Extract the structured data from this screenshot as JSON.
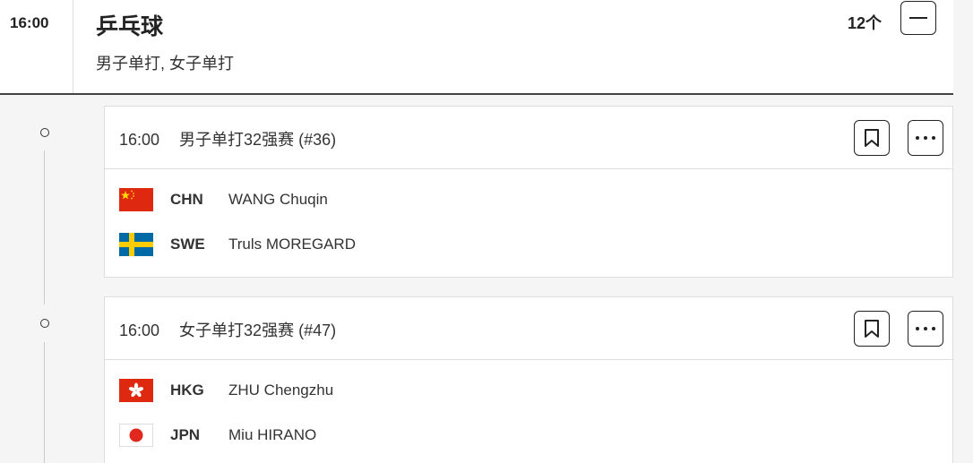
{
  "header": {
    "time": "16:00",
    "sport": "乒乓球",
    "events": "男子单打, 女子单打",
    "count": "12个"
  },
  "matches": [
    {
      "time": "16:00",
      "title": "男子单打32强赛",
      "number": "(#36)",
      "competitors": [
        {
          "code": "CHN",
          "name": "WANG Chuqin",
          "flag": "china-flag-icon"
        },
        {
          "code": "SWE",
          "name": "Truls MOREGARD",
          "flag": "sweden-flag-icon"
        }
      ]
    },
    {
      "time": "16:00",
      "title": "女子单打32强赛",
      "number": "(#47)",
      "competitors": [
        {
          "code": "HKG",
          "name": "ZHU Chengzhu",
          "flag": "hong-kong-flag-icon"
        },
        {
          "code": "JPN",
          "name": "Miu HIRANO",
          "flag": "japan-flag-icon"
        }
      ]
    }
  ],
  "colors": {
    "china_red": "#de2910",
    "china_star": "#ffde00",
    "sweden_blue": "#006aa7",
    "sweden_yellow": "#fecc00",
    "hk_red": "#de2910",
    "japan_red": "#e0281e"
  }
}
